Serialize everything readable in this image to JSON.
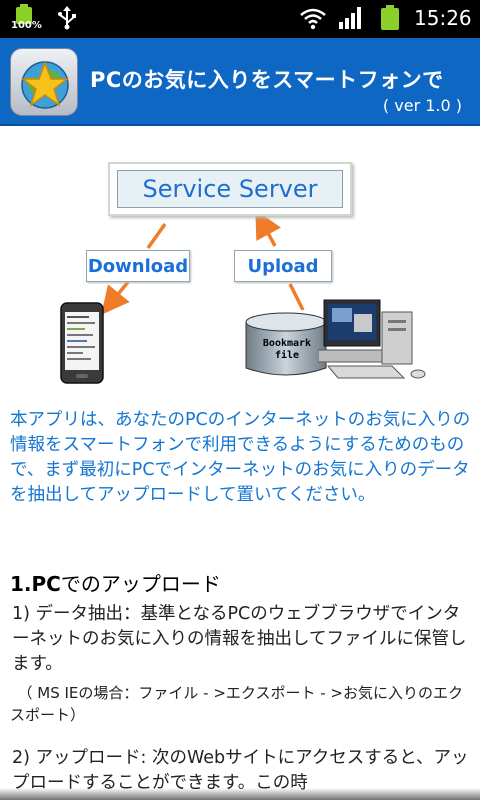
{
  "status_bar": {
    "battery_percent": "100%",
    "time": "15:26"
  },
  "header": {
    "title": "PCのお気に入りをスマートフォンで",
    "version": "( ver 1.0 )"
  },
  "diagram": {
    "server_label": "Service Server",
    "download_label": "Download",
    "upload_label": "Upload",
    "db_label_line1": "Bookmark",
    "db_label_line2": "file"
  },
  "content": {
    "intro": "本アプリは、あなたのPCのインターネットのお気に入りの情報をスマートフォンで利用できるようにするためのもので、まず最初にPCでインターネットのお気に入りのデータを抽出してアップロードして置いてください。",
    "section_number": "1.PC",
    "section_title_rest": "でのアップロード",
    "step1": " 1) データ抽出：基準となるPCのウェブブラウザでインターネットのお気に入りの情報を抽出してファイルに保管します。",
    "note": "　（ MS IEの場合：ファイル - >エクスポート - >お気に入りのエクスポート）",
    "step2": " 2) アップロード: 次のWebサイトにアクセスすると、アップロードすることができます。この時"
  },
  "colors": {
    "header_bg": "#0f67c4",
    "intro_text": "#1476d0",
    "server_text": "#1d6fd0",
    "arrow": "#f07b28"
  },
  "icons": {
    "battery_left": "battery-full-icon",
    "usb": "usb-icon",
    "wifi": "wifi-icon",
    "signal": "signal-icon",
    "battery": "battery-icon",
    "app": "star-globe-icon"
  }
}
